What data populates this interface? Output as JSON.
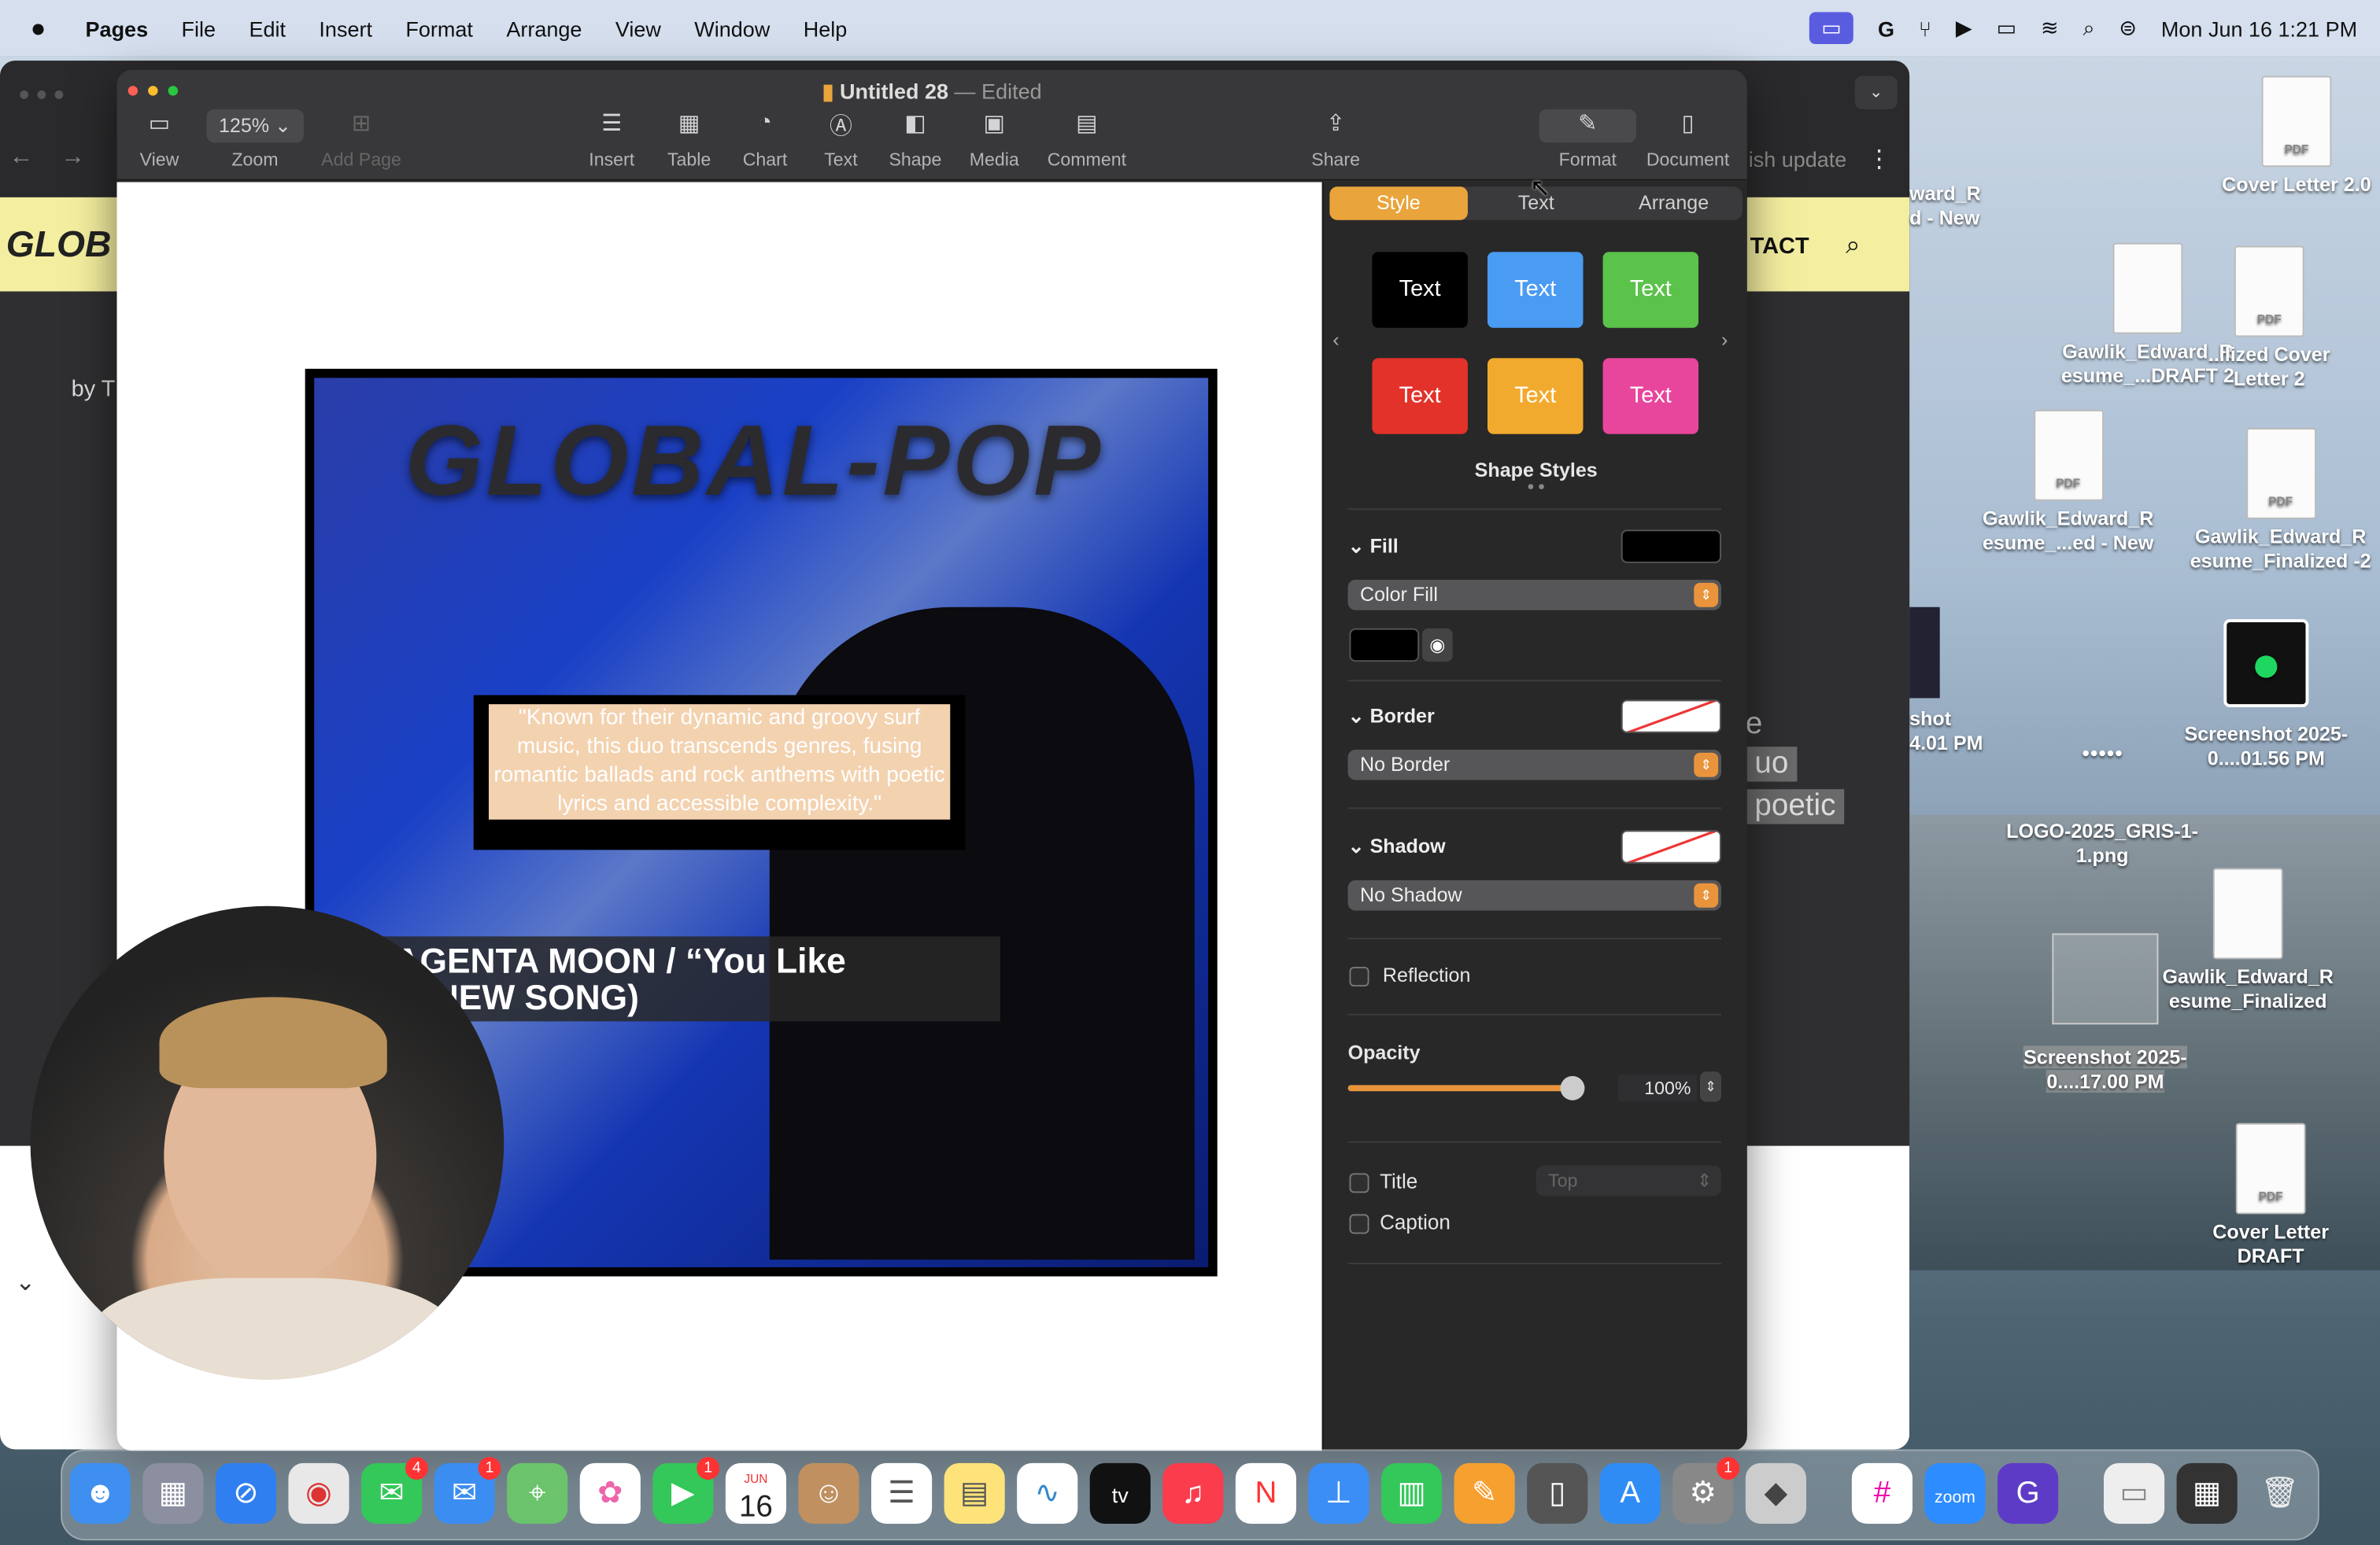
{
  "menubar": {
    "apple": "",
    "app": "Pages",
    "items": [
      "File",
      "Edit",
      "Insert",
      "Format",
      "Arrange",
      "View",
      "Window",
      "Help"
    ],
    "datetime": "Mon Jun 16  1:21 PM"
  },
  "browser": {
    "site_logo": "GLOB",
    "nav_contact": "TACT",
    "byline": "by T",
    "toolbar_text": "ish update",
    "bg_text_1": "e",
    "bg_text_2": "uo",
    "bg_text_3": "poetic"
  },
  "window": {
    "title": "Untitled 28",
    "edited": "— Edited"
  },
  "toolbar": {
    "view": "View",
    "zoom_value": "125%",
    "zoom": "Zoom",
    "add_page": "Add Page",
    "insert": "Insert",
    "table": "Table",
    "chart": "Chart",
    "text": "Text",
    "shape": "Shape",
    "media": "Media",
    "comment": "Comment",
    "share": "Share",
    "format": "Format",
    "document": "Document"
  },
  "panel": {
    "tabs": [
      "Style",
      "Text",
      "Arrange"
    ],
    "styles": [
      {
        "label": "Text",
        "color": "#000000"
      },
      {
        "label": "Text",
        "color": "#4a9bf2"
      },
      {
        "label": "Text",
        "color": "#5bc24a"
      },
      {
        "label": "Text",
        "color": "#e2322a"
      },
      {
        "label": "Text",
        "color": "#f2aa2e"
      },
      {
        "label": "Text",
        "color": "#e8459c"
      }
    ],
    "shape_styles": "Shape Styles",
    "fill": "Fill",
    "fill_type": "Color Fill",
    "border": "Border",
    "border_type": "No Border",
    "shadow": "Shadow",
    "shadow_type": "No Shadow",
    "reflection": "Reflection",
    "opacity": "Opacity",
    "opacity_value": "100%",
    "opacity_level": 1.0,
    "title": "Title",
    "title_position": "Top",
    "caption": "Caption"
  },
  "document": {
    "brand": "GLOBAL-POP",
    "quote": "\"Known for their dynamic and groovy surf music, this duo transcends genres, fusing romantic ballads and rock anthems with poetic lyrics and accessible complexity.\"",
    "song_line1": "AGENTA MOON / “You Like",
    "song_line2": "” (NEW SONG)"
  },
  "desktop_icons": [
    {
      "label": "Cover Letter 2.0"
    },
    {
      "label": "ward_R d - New"
    },
    {
      "label": "Gawlik_Edward_R esume_...DRAFT 2"
    },
    {
      "label": "...lized Cover Letter 2"
    },
    {
      "label": "Gawlik_Edward_R esume_...ed - New"
    },
    {
      "label": "Gawlik_Edward_R esume_Finalized -2"
    },
    {
      "label": "shot 4.01 PM"
    },
    {
      "label": "Screenshot 2025-0....01.56 PM"
    },
    {
      "label": "LOGO-2025_GRIS-1-1.png"
    },
    {
      "label": "Gawlik_Edward_R esume_Finalized"
    },
    {
      "label": "Screenshot 2025-0....17.00 PM"
    },
    {
      "label": "Cover Letter DRAFT"
    }
  ],
  "dock": {
    "messages_badge": "4",
    "mail_badge": "1",
    "facetime_badge": "1",
    "calendar_month": "JUN",
    "calendar_day": "16",
    "tv": "tv",
    "zoom": "zoom",
    "settings_badge": "1"
  }
}
